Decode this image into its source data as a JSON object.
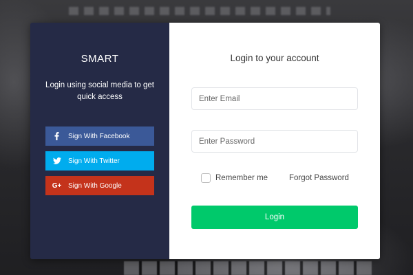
{
  "brand": "SMART",
  "tagline": "Login using social media to get quick access",
  "social": [
    {
      "label": "Sign With Facebook",
      "icon": "facebook-icon",
      "color": "#3b5998"
    },
    {
      "label": "Sign With Twitter",
      "icon": "twitter-icon",
      "color": "#00acee"
    },
    {
      "label": "Sign With Google",
      "icon": "google-plus-icon",
      "color": "#c4331b"
    }
  ],
  "form": {
    "title": "Login to your account",
    "email_placeholder": "Enter Email",
    "password_placeholder": "Enter Password",
    "remember_label": "Remember me",
    "forgot_label": "Forgot Password",
    "login_label": "Login"
  },
  "colors": {
    "panel": "#252a46",
    "login_button": "#00c96b"
  }
}
